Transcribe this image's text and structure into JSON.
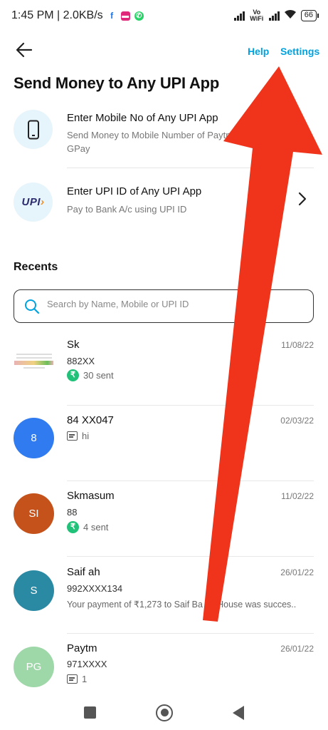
{
  "status_bar": {
    "time": "1:45 PM | 2.0KB/s",
    "network_label": "Vo WiFi",
    "battery": "66"
  },
  "header": {
    "help_label": "Help",
    "settings_label": "Settings"
  },
  "page_title": "Send Money to Any UPI App",
  "options": [
    {
      "title": "Enter Mobile No of Any UPI App",
      "subtitle": "Send Money to Mobile Number of Paytm GPay",
      "icon": "phone-icon"
    },
    {
      "title": "Enter UPI ID of Any UPI App",
      "subtitle": "Pay to Bank A/c using UPI ID",
      "icon": "upi-logo",
      "logo_text": "UPI"
    }
  ],
  "recents_title": "Recents",
  "search": {
    "placeholder": "Search by Name, Mobile or UPI ID"
  },
  "contacts": [
    {
      "name": "Sk",
      "number": "882XX",
      "date": "11/08/22",
      "sub": "30 sent",
      "sub_type": "sent",
      "avatar": "",
      "avatar_color": ""
    },
    {
      "name": "84 XX047",
      "number": "",
      "date": "02/03/22",
      "sub": "hi",
      "sub_type": "message",
      "avatar": "8",
      "avatar_color": "#2f7bef"
    },
    {
      "name": "Skmasum",
      "number": "88",
      "date": "11/02/22",
      "sub": "4 sent",
      "sub_type": "sent",
      "avatar": "SI",
      "avatar_color": "#c4521a"
    },
    {
      "name": "Saif ah",
      "number": "992XXXX134",
      "date": "26/01/22",
      "sub": "Your payment of ₹1,273 to Saif Ba es House was succes..",
      "sub_type": "text",
      "avatar": "S",
      "avatar_color": "#2b8aa3"
    },
    {
      "name": "Paytm",
      "number": "971XXXX",
      "date": "26/01/22",
      "sub": "1",
      "sub_type": "message",
      "avatar": "PG",
      "avatar_color": "#9ed7a8"
    }
  ],
  "colors": {
    "accent": "#00a3e0",
    "arrow": "#f0341c",
    "sent_badge": "#21c17a"
  }
}
